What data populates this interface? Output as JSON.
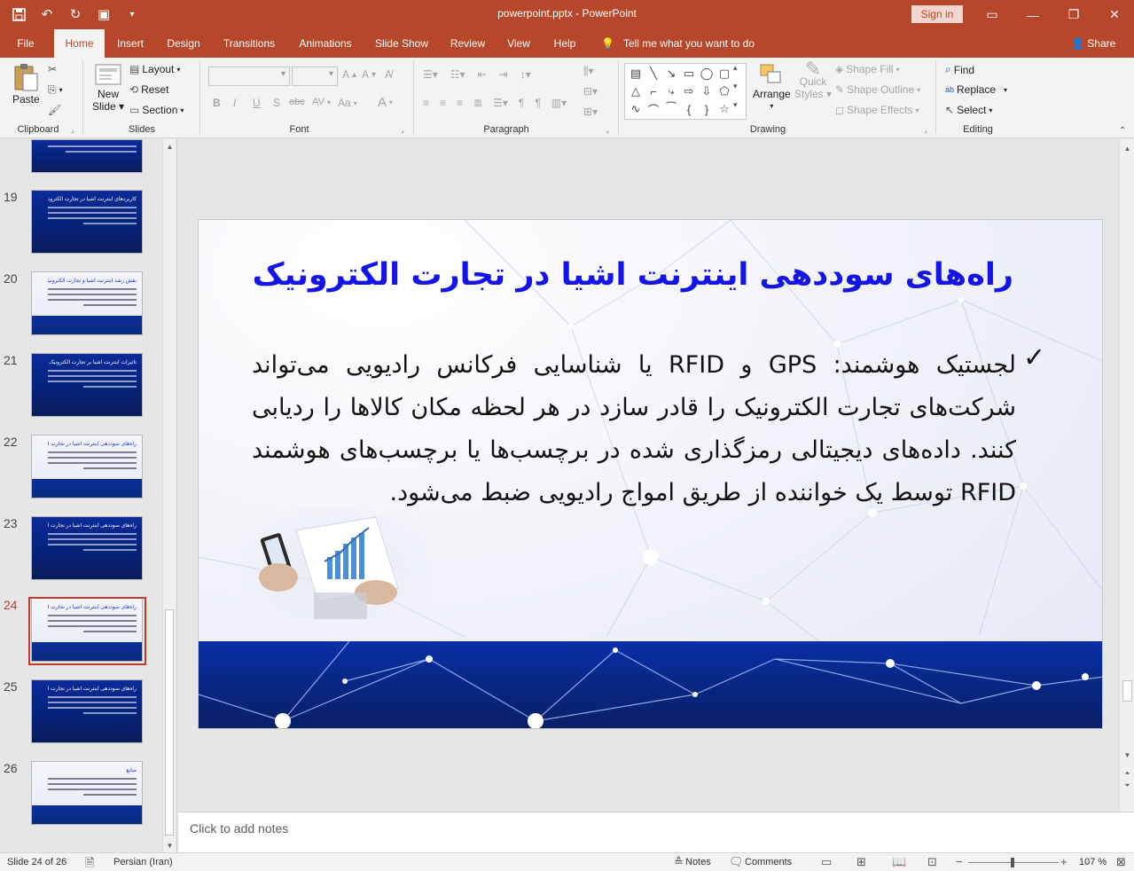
{
  "window": {
    "doc_title": "powerpoint.pptx  -  PowerPoint",
    "sign_in": "Sign in",
    "qat_icons": [
      "save-icon",
      "undo-icon",
      "redo-icon",
      "present-icon",
      "customize-icon"
    ]
  },
  "tabs": [
    "File",
    "Home",
    "Insert",
    "Design",
    "Transitions",
    "Animations",
    "Slide Show",
    "Review",
    "View",
    "Help"
  ],
  "active_tab": "Home",
  "tell_me": "Tell me what you want to do",
  "share": "Share",
  "ribbon": {
    "clipboard": {
      "label": "Clipboard",
      "paste": "Paste"
    },
    "slides": {
      "label": "Slides",
      "new_slide_1": "New",
      "new_slide_2": "Slide",
      "layout": "Layout",
      "reset": "Reset",
      "section": "Section"
    },
    "font": {
      "label": "Font",
      "bold": "B",
      "italic": "I",
      "underline": "U",
      "shadow": "S",
      "strike": "abc",
      "spacing": "AV",
      "case": "Aa",
      "color": "A"
    },
    "paragraph": {
      "label": "Paragraph"
    },
    "drawing": {
      "label": "Drawing",
      "arrange": "Arrange",
      "quick_styles_1": "Quick",
      "quick_styles_2": "Styles",
      "shape_fill": "Shape Fill",
      "shape_outline": "Shape Outline",
      "shape_effects": "Shape Effects"
    },
    "editing": {
      "label": "Editing",
      "find": "Find",
      "replace": "Replace",
      "select": "Select"
    }
  },
  "thumbnails": [
    {
      "num": "19",
      "style": "dark",
      "title": "کاربردهای اینترنت اشیا در تجارت الکترونیک"
    },
    {
      "num": "20",
      "style": "light",
      "title": "نقش رشد اینترنت اشیا و تجارت الکترونیک در توسعه بازار"
    },
    {
      "num": "21",
      "style": "dark",
      "title": "تاثیرات اینترنت اشیا بر تجارت الکترونیک"
    },
    {
      "num": "22",
      "style": "light",
      "title": "راه‌های سوددهی اینترنت اشیا در تجارت الکترونیک"
    },
    {
      "num": "23",
      "style": "dark",
      "title": "راه‌های سوددهی اینترنت اشیا در تجارت الکترونیک"
    },
    {
      "num": "24",
      "style": "light",
      "title": "راه‌های سوددهی اینترنت اشیا در تجارت الکترونیک"
    },
    {
      "num": "25",
      "style": "dark",
      "title": "راه‌های سوددهی اینترنت اشیا در تجارت الکترونیک"
    },
    {
      "num": "26",
      "style": "light",
      "title": "منابع"
    }
  ],
  "selected_slide": "24",
  "slide": {
    "title": "راه‌های سوددهی اینترنت اشیا در تجارت الکترونیک",
    "bullet": "✓",
    "body": "لجستیک هوشمند: GPS و RFID یا شناسایی فرکانس رادیویی می‌تواند شرکت‌های تجارت الکترونیک را قادر سازد در هر لحظه مکان کالاها را ردیابی کنند. داده‌های دیجیتالی رمزگذاری شده در برچسب‌ها یا برچسب‌های هوشمند RFID توسط یک خواننده از طریق امواج رادیویی ضبط می‌شود."
  },
  "notes_placeholder": "Click to add notes",
  "status": {
    "slide_of": "Slide 24 of 26",
    "language": "Persian (Iran)",
    "notes": "Notes",
    "comments": "Comments",
    "zoom": "107 %"
  },
  "colors": {
    "accent": "#b7472a",
    "title_blue": "#1414e6",
    "band_blue": "#0a2fa8"
  }
}
